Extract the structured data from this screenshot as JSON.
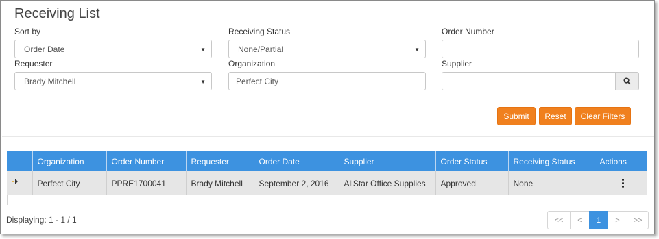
{
  "page": {
    "title": "Receiving List"
  },
  "filters": {
    "sort_by": {
      "label": "Sort by",
      "value": "Order Date"
    },
    "receiving_status": {
      "label": "Receiving Status",
      "value": "None/Partial"
    },
    "order_number": {
      "label": "Order Number",
      "value": ""
    },
    "requester": {
      "label": "Requester",
      "value": "Brady Mitchell"
    },
    "organization": {
      "label": "Organization",
      "value": "Perfect City"
    },
    "supplier": {
      "label": "Supplier",
      "value": ""
    }
  },
  "buttons": {
    "submit": "Submit",
    "reset": "Reset",
    "clear_filters": "Clear Filters"
  },
  "table": {
    "columns": [
      "Organization",
      "Order Number",
      "Requester",
      "Order Date",
      "Supplier",
      "Order Status",
      "Receiving Status",
      "Actions"
    ],
    "rows": [
      {
        "organization": "Perfect City",
        "order_number": "PPRE1700041",
        "requester": "Brady Mitchell",
        "order_date": "September 2, 2016",
        "supplier": "AllStar Office Supplies",
        "order_status": "Approved",
        "receiving_status": "None"
      }
    ]
  },
  "footer": {
    "displaying": "Displaying: 1 - 1 / 1"
  },
  "pagination": {
    "first": "<<",
    "prev": "<",
    "current": "1",
    "next": ">",
    "last": ">>"
  },
  "icons": {
    "dropdown": "caret-down-icon",
    "search": "magnifier-icon",
    "expand": "expand-row-icon",
    "actions": "kebab-menu-icon"
  },
  "colors": {
    "header_blue": "#3d92e0",
    "button_orange": "#f0801e"
  }
}
